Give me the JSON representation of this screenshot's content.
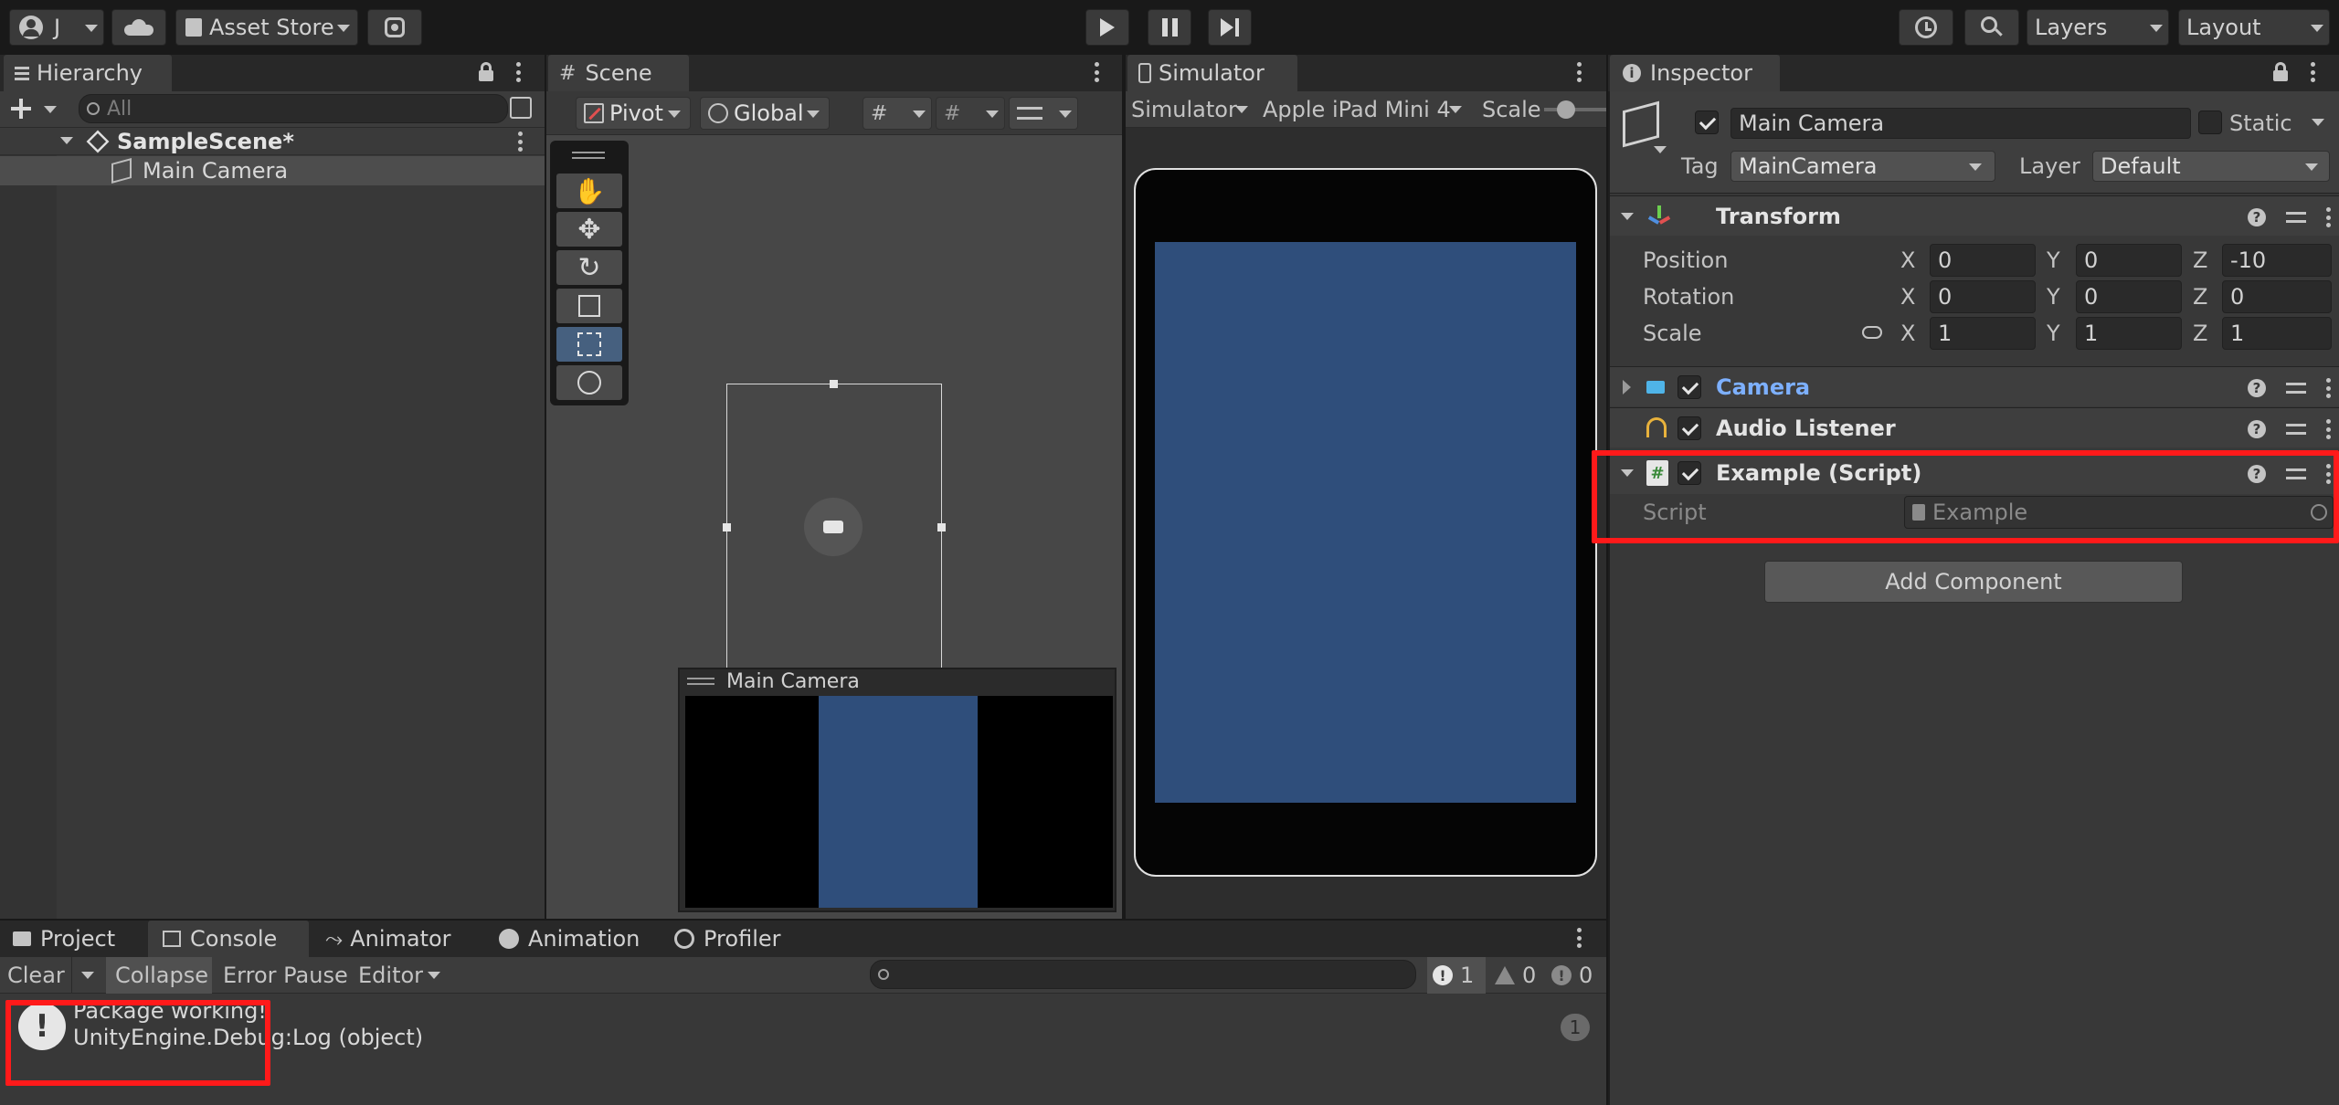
{
  "toolbar": {
    "account_label": "J",
    "asset_store_label": "Asset Store",
    "layers_label": "Layers",
    "layout_label": "Layout"
  },
  "hierarchy": {
    "tab_label": "Hierarchy",
    "search_placeholder": "All",
    "scene_name": "SampleScene*",
    "items": [
      "Main Camera"
    ]
  },
  "scene": {
    "tab_label": "Scene",
    "pivot_label": "Pivot",
    "global_label": "Global",
    "camera_preview_title": "Main Camera"
  },
  "simulator": {
    "tab_label": "Simulator",
    "mode_label": "Simulator",
    "device_label": "Apple iPad Mini 4",
    "scale_label": "Scale"
  },
  "inspector": {
    "tab_label": "Inspector",
    "object_name": "Main Camera",
    "static_label": "Static",
    "tag_label": "Tag",
    "tag_value": "MainCamera",
    "layer_label": "Layer",
    "layer_value": "Default",
    "transform": {
      "title": "Transform",
      "rows": [
        {
          "label": "Position",
          "x": "0",
          "y": "0",
          "z": "-10"
        },
        {
          "label": "Rotation",
          "x": "0",
          "y": "0",
          "z": "0"
        },
        {
          "label": "Scale",
          "x": "1",
          "y": "1",
          "z": "1"
        }
      ],
      "axis_x": "X",
      "axis_y": "Y",
      "axis_z": "Z"
    },
    "components": {
      "camera": "Camera",
      "audio_listener": "Audio Listener",
      "example_script": "Example (Script)",
      "script_label": "Script",
      "script_value": "Example"
    },
    "add_component_label": "Add Component"
  },
  "bottom_tabs": {
    "project": "Project",
    "console": "Console",
    "animator": "Animator",
    "animation": "Animation",
    "profiler": "Profiler"
  },
  "console": {
    "clear_label": "Clear",
    "collapse_label": "Collapse",
    "error_pause_label": "Error Pause",
    "editor_label": "Editor",
    "log_count": "1",
    "warning_count": "0",
    "error_count": "0",
    "entry_line1": "Package working!",
    "entry_line2": "UnityEngine.Debug:Log (object)",
    "entry_count": "1"
  },
  "colors": {
    "accent_blue": "#2f4e7b",
    "highlight_red": "#ff1a1a",
    "camera_link_blue": "#7db0ff"
  }
}
